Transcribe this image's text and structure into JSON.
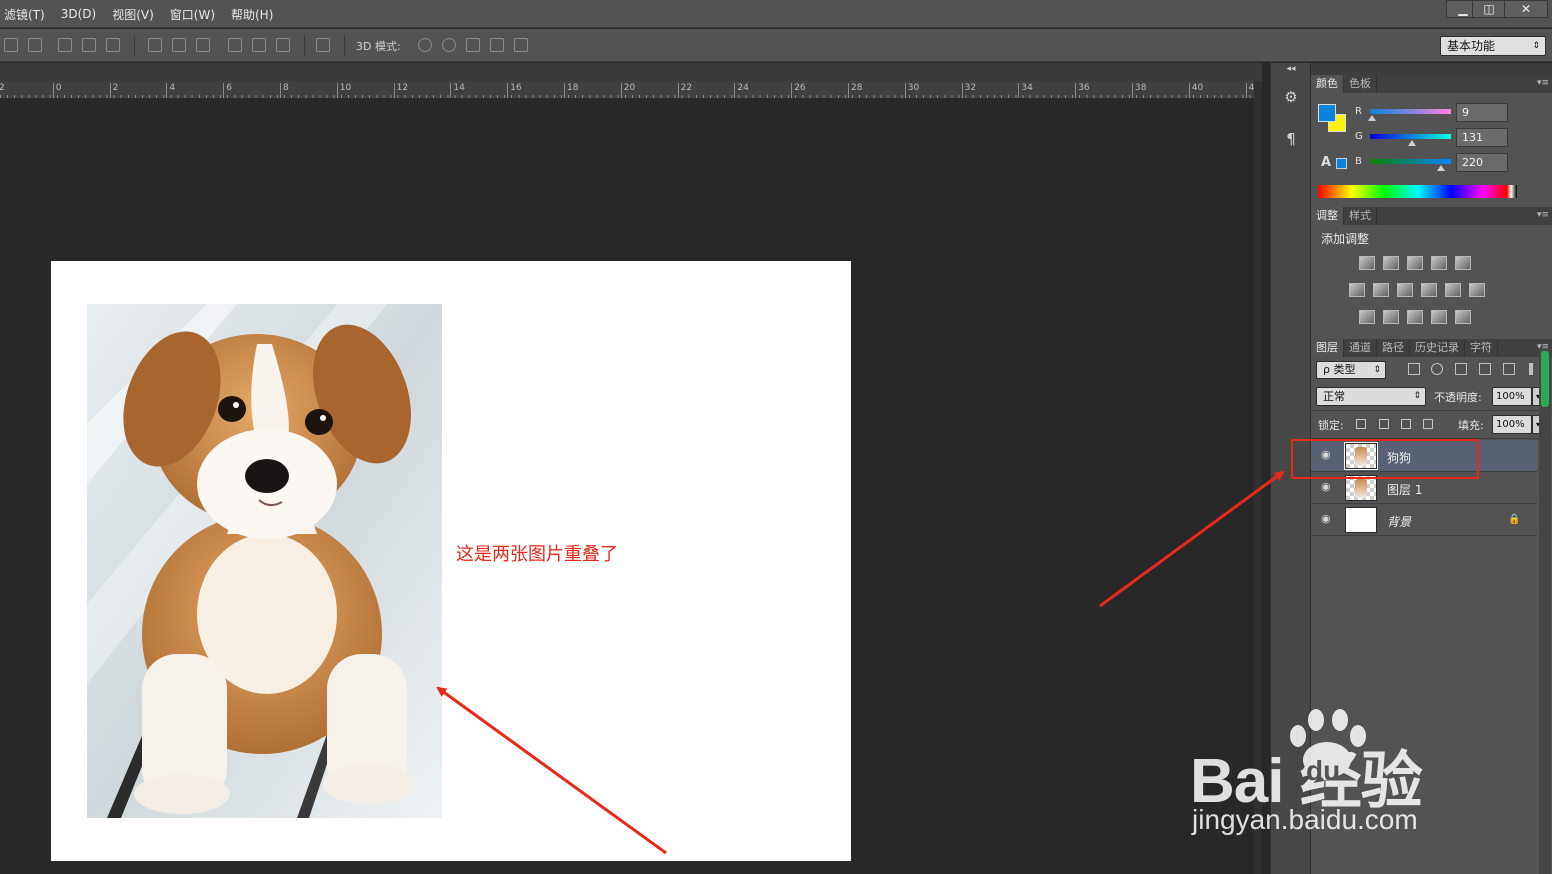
{
  "menu": {
    "items": [
      "滤镜(T)",
      "3D(D)",
      "视图(V)",
      "窗口(W)",
      "帮助(H)"
    ]
  },
  "window_controls": {
    "minimize": "▁",
    "restore": "◫",
    "close": "✕"
  },
  "options_bar": {
    "mode_label": "3D 模式:",
    "workspace": "基本功能",
    "workspace_arrow": "⇕"
  },
  "ruler": {
    "ticks": [
      "2",
      "0",
      "2",
      "4",
      "6",
      "8",
      "10",
      "12",
      "14",
      "16",
      "18",
      "20",
      "22",
      "24",
      "26",
      "28",
      "30",
      "32",
      "34",
      "36",
      "38",
      "40",
      "4"
    ]
  },
  "document": {
    "annotation": "这是两张图片重叠了"
  },
  "strip": {
    "icon1": "⚙",
    "icon2": "¶",
    "collapse": "◂◂"
  },
  "color_panel": {
    "tabs": [
      "颜色",
      "色板"
    ],
    "menu": "▾≡",
    "fg_color": "#0983dc",
    "bg_color": "#fff200",
    "warning_icon": "A",
    "r": {
      "label": "R",
      "value": "9"
    },
    "g": {
      "label": "G",
      "value": "131"
    },
    "b": {
      "label": "B",
      "value": "220"
    }
  },
  "adjust_panel": {
    "tabs": [
      "调整",
      "样式"
    ],
    "menu": "▾≡",
    "title": "添加调整",
    "icons_row1": [
      "brightness-icon",
      "levels-icon",
      "curves-icon",
      "exposure-icon",
      "vibrance-icon"
    ],
    "icons_row2": [
      "hue-icon",
      "color-balance-icon",
      "bw-icon",
      "photo-filter-icon",
      "channel-mixer-icon",
      "color-lookup-icon"
    ],
    "icons_row3": [
      "invert-icon",
      "posterize-icon",
      "threshold-icon",
      "selective-color-icon",
      "gradient-map-icon"
    ]
  },
  "layers_panel": {
    "tabs": [
      "图层",
      "通道",
      "路径",
      "历史记录",
      "字符"
    ],
    "menu": "▾≡",
    "filter_label": "ρ 类型",
    "filter_arrow": "⇕",
    "blend_mode": "正常",
    "blend_arrow": "⇕",
    "opacity_label": "不透明度:",
    "opacity_value": "100%",
    "lock_label": "锁定:",
    "fill_label": "填充:",
    "fill_value": "100%",
    "spin_arrow": "▾",
    "layers": [
      {
        "name": "狗狗",
        "eye": "◉",
        "selected": true
      },
      {
        "name": "图层 1",
        "eye": "◉",
        "selected": false
      },
      {
        "name": "背景",
        "eye": "◉",
        "selected": false,
        "locked": true,
        "lock": "🔒"
      }
    ]
  },
  "annotation_colors": {
    "arrow": "#e8281b"
  },
  "watermark": {
    "brand": "Bai 经验",
    "du": "du",
    "url": "jingyan.baidu.com"
  }
}
